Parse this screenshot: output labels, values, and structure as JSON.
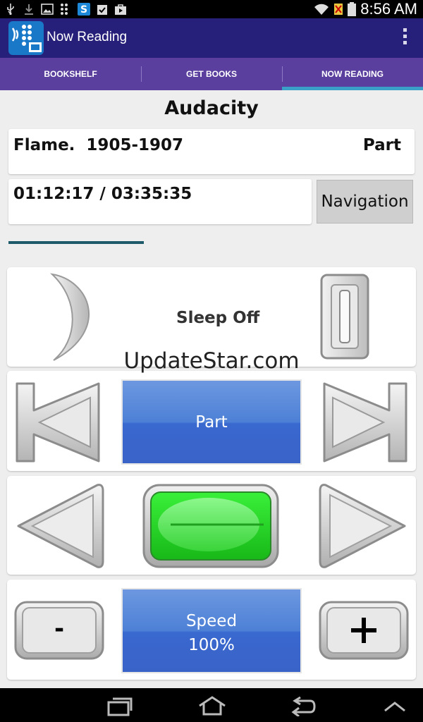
{
  "status_bar": {
    "time": "8:56 AM",
    "icons": [
      "usb-icon",
      "download-icon",
      "image-icon",
      "dots-icon",
      "s-app-icon",
      "clipboard-check-icon",
      "shopping-bag-icon",
      "wifi-icon",
      "no-sim-icon",
      "battery-icon"
    ]
  },
  "app_bar": {
    "title": "Now Reading",
    "overflow_icon": "overflow-menu-icon"
  },
  "tabs": [
    {
      "label": "BOOKSHELF",
      "active": false
    },
    {
      "label": "GET BOOKS",
      "active": false
    },
    {
      "label": "NOW READING",
      "active": true
    }
  ],
  "book": {
    "title": "Audacity",
    "chapter": "Flame.  1905-1907",
    "part_label": "Part",
    "time": "01:12:17 / 03:35:35",
    "navigation_label": "Navigation",
    "progress_fraction": 0.333
  },
  "controls": {
    "sleep_label": "Sleep Off",
    "part_button_label": "Part",
    "speed_label": "Speed",
    "speed_value": "100%",
    "minus_label": "-"
  },
  "watermark": "UpdateStar.com",
  "nav_bar": {
    "icons": [
      "recent-apps-icon",
      "home-icon",
      "back-icon",
      "chevron-up-icon"
    ]
  },
  "colors": {
    "app_bar": "#27207a",
    "tabs": "#5a3f9e",
    "tab_indicator": "#3aa0c8",
    "blue_button": "#4d80d6",
    "play_green": "#2fd82f"
  }
}
